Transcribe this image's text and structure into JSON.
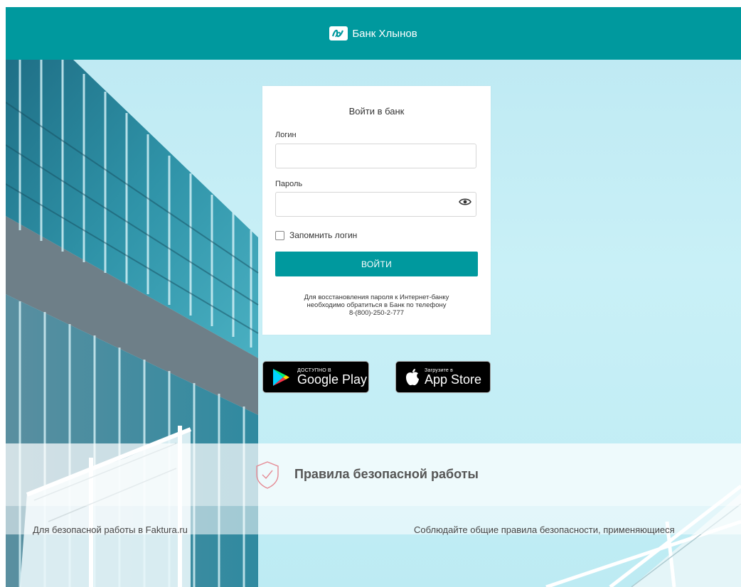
{
  "header": {
    "bank_name": "Банк Хлынов",
    "logo_icon": "bank-logo-icon"
  },
  "login": {
    "title": "Войти в банк",
    "login_label": "Логин",
    "login_value": "",
    "password_label": "Пароль",
    "password_value": "",
    "remember_label": "Запомнить логин",
    "remember_checked": false,
    "submit_label": "ВОЙТИ",
    "recovery_text": "Для восстановления пароля к Интернет-банку\nнеобходимо обратиться в Банк по телефону\n8-(800)-250-2-777"
  },
  "stores": {
    "google_small": "ДОСТУПНО В",
    "google_big": "Google Play",
    "apple_small": "Загрузите в",
    "apple_big": "App Store"
  },
  "rules": {
    "title": "Правила безопасной работы",
    "left_text": "Для безопасной работы в Faktura.ru",
    "right_text": "Соблюдайте общие правила безопасности, применяющиеся"
  },
  "colors": {
    "accent": "#00999e",
    "sky": "#c9f0f7"
  }
}
